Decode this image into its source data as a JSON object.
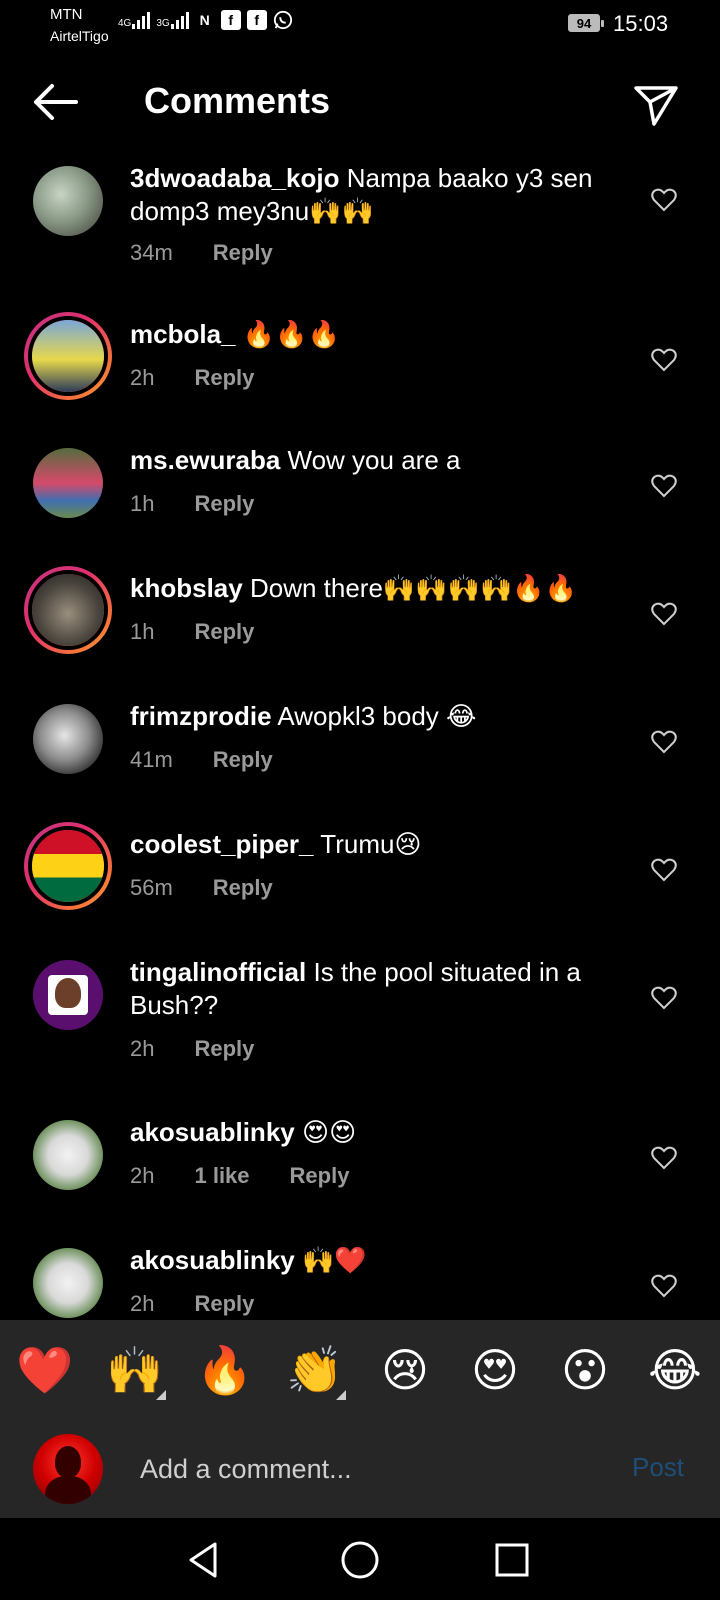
{
  "status_bar": {
    "carrier_primary": "MTN",
    "carrier_secondary": "AirtelTigo",
    "network1": "4G",
    "network2": "3G",
    "battery": "94",
    "time": "15:03",
    "notification_icons": [
      "N",
      "f",
      "f",
      "whatsapp"
    ]
  },
  "header": {
    "title": "Comments",
    "back_icon": "arrow-left-icon",
    "send_icon": "paper-plane-icon"
  },
  "comments": [
    {
      "username": "3dwoadaba_kojo",
      "text": "Nampa baako y3 sen domp3 mey3nu🙌🙌",
      "time": "34m",
      "likes": "",
      "reply": "Reply"
    },
    {
      "username": "mcbola_",
      "text": "🔥🔥🔥",
      "time": "2h",
      "likes": "",
      "reply": "Reply"
    },
    {
      "username": "ms.ewuraba",
      "text": "Wow you are a",
      "time": "1h",
      "likes": "",
      "reply": "Reply"
    },
    {
      "username": "khobslay",
      "text": "Down there🙌🙌🙌🙌🔥🔥",
      "time": "1h",
      "likes": "",
      "reply": "Reply"
    },
    {
      "username": "frimzprodie",
      "text": "Awopkl3 body 😂",
      "time": "41m",
      "likes": "",
      "reply": "Reply"
    },
    {
      "username": "coolest_piper_",
      "text": "Trumu😢",
      "time": "56m",
      "likes": "",
      "reply": "Reply"
    },
    {
      "username": "tingalinofficial",
      "text": "Is the pool situated in a Bush??",
      "time": "2h",
      "likes": "",
      "reply": "Reply"
    },
    {
      "username": "akosuablinky",
      "text": "😍😍",
      "time": "2h",
      "likes": "1 like",
      "reply": "Reply"
    },
    {
      "username": "akosuablinky",
      "text": "🙌❤️",
      "time": "2h",
      "likes": "",
      "reply": "Reply"
    }
  ],
  "emoji_bar": [
    "❤️",
    "🙌",
    "🔥",
    "👏",
    "😢",
    "😍",
    "😮",
    "😂"
  ],
  "composer": {
    "placeholder": "Add a comment...",
    "post_label": "Post"
  },
  "colors": {
    "background": "#000000",
    "panel": "#262626",
    "muted_text": "#9a9a9a",
    "post_disabled": "#1f4e78",
    "story_ring_start": "#c13584",
    "story_ring_end": "#fcaf45"
  }
}
